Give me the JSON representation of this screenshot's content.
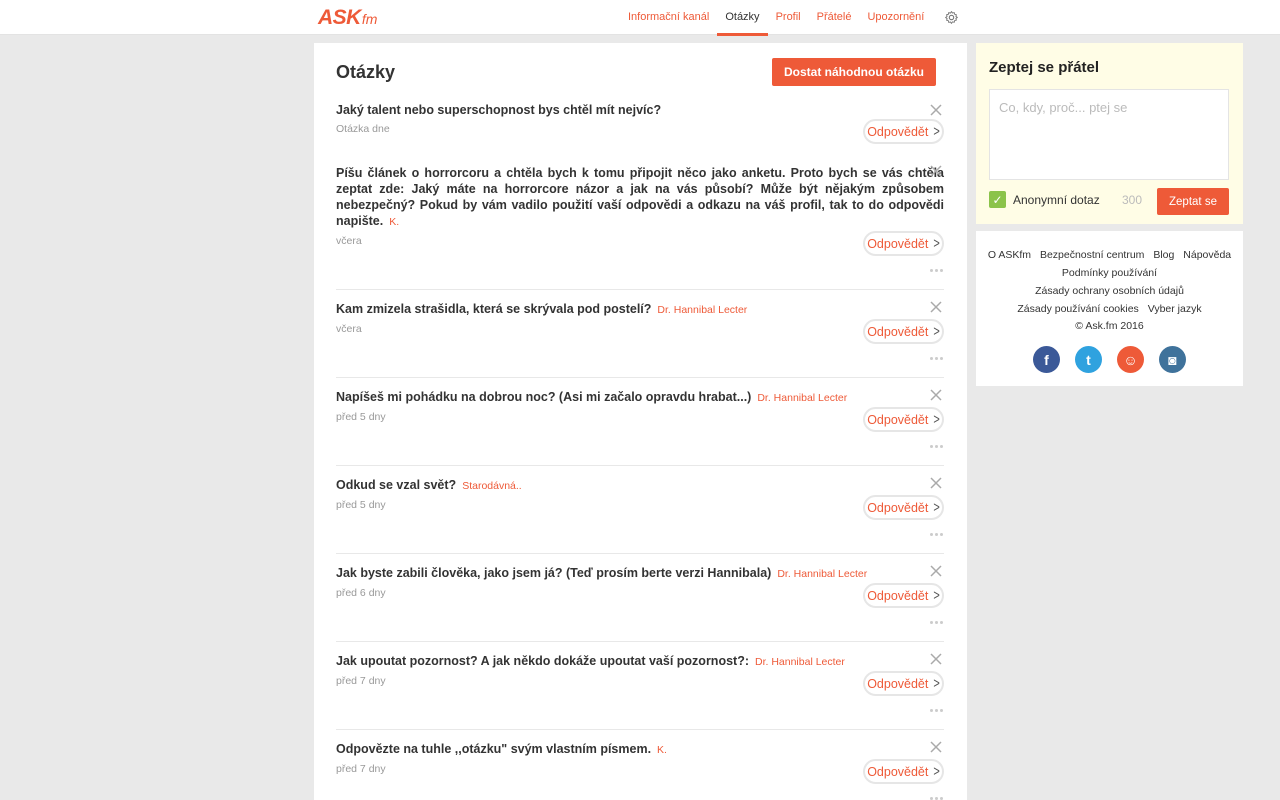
{
  "brand": {
    "logo_main": "ASK",
    "logo_suffix": "fm"
  },
  "nav": {
    "items": [
      {
        "label": "Informační kanál",
        "active": false
      },
      {
        "label": "Otázky",
        "active": true
      },
      {
        "label": "Profil",
        "active": false
      },
      {
        "label": "Přátelé",
        "active": false
      },
      {
        "label": "Upozornění",
        "active": false
      }
    ]
  },
  "main": {
    "title": "Otázky",
    "random_button": "Dostat náhodnou otázku",
    "answer_label": "Odpovědět",
    "questions": [
      {
        "text": "Jaký talent nebo superschopnost bys chtěl mít nejvíc?",
        "author": "",
        "time": "Otázka dne"
      },
      {
        "text": "Píšu článek o horrorcoru a chtěla bych k tomu připojit něco jako anketu. Proto bych se vás chtěla zeptat zde: Jaký máte na horrorcore názor a jak na vás působí? Může být nějakým způsobem nebezpečný? Pokud by vám vadilo použití vaší odpovědi a odkazu na váš profil, tak to do odpovědi napište.",
        "author": "K.",
        "time": "včera"
      },
      {
        "text": "Kam zmizela strašidla, která se skrývala pod postelí?",
        "author": "Dr. Hannibal Lecter",
        "time": "včera"
      },
      {
        "text": "Napíšeš mi pohádku na dobrou noc? (Asi mi začalo opravdu hrabat...)",
        "author": "Dr. Hannibal Lecter",
        "time": "před 5 dny"
      },
      {
        "text": "Odkud se vzal svět?",
        "author": "Starodávná..",
        "time": "před 5 dny"
      },
      {
        "text": "Jak byste zabili člověka, jako jsem já? (Teď prosím berte verzi Hannibala)",
        "author": "Dr. Hannibal Lecter",
        "time": "před 6 dny"
      },
      {
        "text": "Jak upoutat pozornost? A jak někdo dokáže upoutat vaší pozornost?:",
        "author": "Dr. Hannibal Lecter",
        "time": "před 7 dny"
      },
      {
        "text": "Odpovězte na tuhle ,,otázku\" svým vlastním písmem.",
        "author": "K.",
        "time": "před 7 dny"
      }
    ]
  },
  "ask": {
    "title": "Zeptej se přátel",
    "placeholder": "Co, kdy, proč... ptej se",
    "anonymous_label": "Anonymní dotaz",
    "anonymous_checked": true,
    "char_counter": "300",
    "submit": "Zeptat se"
  },
  "footer": {
    "links_row1": [
      "O ASKfm",
      "Bezpečnostní centrum",
      "Blog",
      "Nápověda"
    ],
    "links_row2": [
      "Podmínky používání"
    ],
    "links_row3": [
      "Zásady ochrany osobních údajů"
    ],
    "links_row4": [
      "Zásady používání cookies",
      "Vyber jazyk"
    ],
    "copyright": "© Ask.fm 2016",
    "social": [
      {
        "name": "facebook-icon",
        "glyph": "f",
        "color": "#3b5998"
      },
      {
        "name": "twitter-icon",
        "glyph": "t",
        "color": "#2fa2df"
      },
      {
        "name": "askfm-icon",
        "glyph": "☺",
        "color": "#ee5a38"
      },
      {
        "name": "instagram-icon",
        "glyph": "◙",
        "color": "#3f729b"
      }
    ]
  },
  "colors": {
    "accent": "#ee5a38",
    "check": "#8bc34a"
  }
}
